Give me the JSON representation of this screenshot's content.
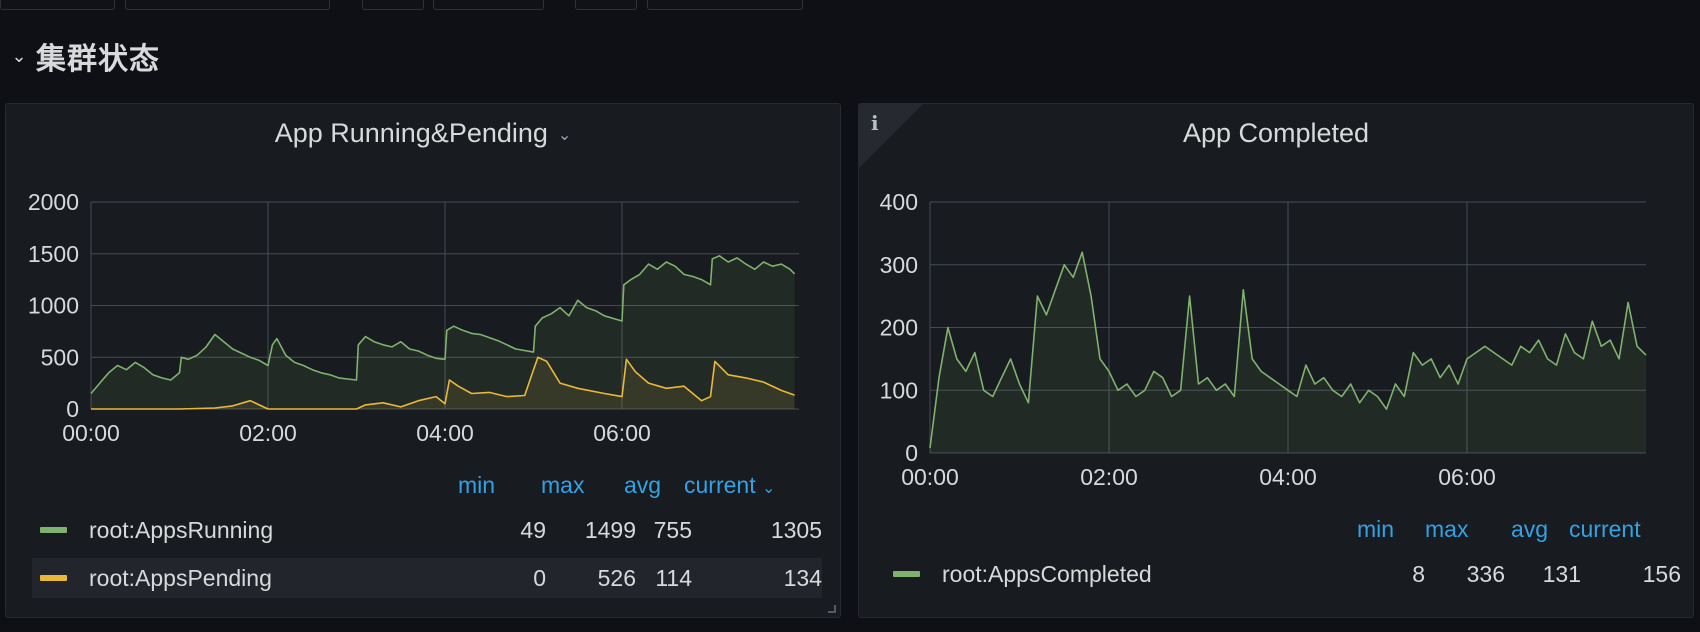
{
  "row": {
    "title": "集群状态",
    "collapse_icon": "chevron-down-icon"
  },
  "colors": {
    "background": "#0f1015",
    "panel_bg": "#181b1f",
    "grid": "#464c54",
    "running": "#7eb26d",
    "pending": "#eab839",
    "completed": "#7eb26d",
    "legend_header": "#33a2e5"
  },
  "panels": [
    {
      "title": "App Running&Pending",
      "menu_icon": "chevron-down-icon",
      "legend": {
        "headers": {
          "min": "min",
          "max": "max",
          "avg": "avg",
          "current": "current"
        },
        "sort_icon": "chevron-down-icon",
        "rows": [
          {
            "name": "root:AppsRunning",
            "min": "49",
            "max": "1499",
            "avg": "755",
            "current": "1305"
          },
          {
            "name": "root:AppsPending",
            "min": "0",
            "max": "526",
            "avg": "114",
            "current": "134"
          }
        ]
      }
    },
    {
      "title": "App Completed",
      "info_icon": "info-icon",
      "legend": {
        "headers": {
          "min": "min",
          "max": "max",
          "avg": "avg",
          "current": "current"
        },
        "rows": [
          {
            "name": "root:AppsCompleted",
            "min": "8",
            "max": "336",
            "avg": "131",
            "current": "156"
          }
        ]
      }
    }
  ],
  "chart_data": [
    {
      "type": "area",
      "x_ticks": [
        "00:00",
        "02:00",
        "04:00",
        "06:00"
      ],
      "x_range": [
        0,
        8
      ],
      "ylim": [
        0,
        2000
      ],
      "y_ticks": [
        "0",
        "500",
        "1000",
        "1500",
        "2000"
      ],
      "y_tick_values": [
        0,
        500,
        1000,
        1500,
        2000
      ],
      "grid": true,
      "series": [
        {
          "name": "root:AppsRunning",
          "color": "#7eb26d",
          "x": [
            0,
            0.1,
            0.2,
            0.3,
            0.4,
            0.5,
            0.6,
            0.7,
            0.8,
            0.9,
            1.0,
            1.02,
            1.1,
            1.2,
            1.3,
            1.4,
            1.5,
            1.6,
            1.7,
            1.8,
            1.9,
            2.0,
            2.05,
            2.1,
            2.2,
            2.3,
            2.4,
            2.5,
            2.6,
            2.7,
            2.8,
            2.9,
            3.0,
            3.02,
            3.1,
            3.2,
            3.3,
            3.4,
            3.5,
            3.6,
            3.7,
            3.8,
            3.9,
            4.0,
            4.02,
            4.1,
            4.2,
            4.3,
            4.4,
            4.5,
            4.6,
            4.7,
            4.8,
            5.0,
            5.02,
            5.1,
            5.2,
            5.3,
            5.4,
            5.5,
            5.6,
            5.7,
            5.8,
            6.0,
            6.02,
            6.1,
            6.2,
            6.3,
            6.4,
            6.5,
            6.6,
            6.7,
            6.8,
            6.9,
            7.0,
            7.02,
            7.1,
            7.2,
            7.3,
            7.4,
            7.5,
            7.6,
            7.7,
            7.8,
            7.9,
            7.95
          ],
          "values": [
            150,
            250,
            350,
            420,
            380,
            450,
            400,
            330,
            300,
            280,
            350,
            500,
            480,
            520,
            600,
            720,
            650,
            580,
            540,
            500,
            470,
            420,
            620,
            680,
            520,
            450,
            420,
            380,
            350,
            330,
            300,
            290,
            280,
            620,
            700,
            650,
            620,
            600,
            650,
            580,
            560,
            520,
            490,
            480,
            760,
            800,
            760,
            730,
            720,
            690,
            660,
            620,
            580,
            550,
            800,
            880,
            920,
            980,
            900,
            1050,
            980,
            950,
            900,
            850,
            1200,
            1250,
            1300,
            1400,
            1350,
            1420,
            1380,
            1300,
            1280,
            1250,
            1200,
            1450,
            1480,
            1420,
            1460,
            1400,
            1350,
            1420,
            1380,
            1400,
            1350,
            1305
          ]
        },
        {
          "name": "root:AppsPending",
          "color": "#eab839",
          "x": [
            0,
            0.5,
            1.0,
            1.4,
            1.6,
            1.8,
            2.0,
            2.5,
            3.0,
            3.1,
            3.3,
            3.5,
            3.7,
            3.9,
            4.0,
            4.05,
            4.15,
            4.3,
            4.5,
            4.7,
            4.9,
            5.0,
            5.05,
            5.15,
            5.3,
            5.5,
            5.8,
            6.0,
            6.05,
            6.15,
            6.3,
            6.5,
            6.7,
            6.9,
            7.0,
            7.05,
            7.2,
            7.4,
            7.6,
            7.8,
            7.95
          ],
          "values": [
            0,
            0,
            0,
            10,
            30,
            80,
            0,
            0,
            0,
            40,
            60,
            20,
            80,
            120,
            50,
            280,
            220,
            150,
            160,
            120,
            130,
            380,
            500,
            460,
            250,
            200,
            150,
            120,
            480,
            360,
            250,
            200,
            220,
            80,
            120,
            460,
            330,
            300,
            260,
            180,
            134
          ]
        }
      ]
    },
    {
      "type": "area",
      "x_ticks": [
        "00:00",
        "02:00",
        "04:00",
        "06:00"
      ],
      "x_range": [
        0,
        8
      ],
      "ylim": [
        0,
        400
      ],
      "y_ticks": [
        "0",
        "100",
        "200",
        "300",
        "400"
      ],
      "y_tick_values": [
        0,
        100,
        200,
        300,
        400
      ],
      "grid": true,
      "series": [
        {
          "name": "root:AppsCompleted",
          "color": "#7eb26d",
          "x": [
            0,
            0.1,
            0.2,
            0.3,
            0.4,
            0.5,
            0.6,
            0.7,
            0.8,
            0.9,
            1.0,
            1.1,
            1.2,
            1.3,
            1.4,
            1.5,
            1.6,
            1.7,
            1.8,
            1.9,
            2.0,
            2.1,
            2.2,
            2.3,
            2.4,
            2.5,
            2.6,
            2.7,
            2.8,
            2.9,
            3.0,
            3.1,
            3.2,
            3.3,
            3.4,
            3.5,
            3.6,
            3.7,
            3.8,
            3.9,
            4.0,
            4.1,
            4.2,
            4.3,
            4.4,
            4.5,
            4.6,
            4.7,
            4.8,
            4.9,
            5.0,
            5.1,
            5.2,
            5.3,
            5.4,
            5.5,
            5.6,
            5.7,
            5.8,
            5.9,
            6.0,
            6.1,
            6.2,
            6.3,
            6.4,
            6.5,
            6.6,
            6.7,
            6.8,
            6.9,
            7.0,
            7.1,
            7.2,
            7.3,
            7.4,
            7.5,
            7.6,
            7.7,
            7.8,
            7.9,
            8.0
          ],
          "values": [
            8,
            120,
            200,
            150,
            130,
            160,
            100,
            90,
            120,
            150,
            110,
            80,
            250,
            220,
            260,
            300,
            280,
            320,
            250,
            150,
            130,
            100,
            110,
            90,
            100,
            130,
            120,
            90,
            100,
            250,
            110,
            120,
            100,
            110,
            90,
            260,
            150,
            130,
            120,
            110,
            100,
            90,
            140,
            110,
            120,
            100,
            90,
            110,
            80,
            100,
            90,
            70,
            110,
            90,
            160,
            140,
            150,
            120,
            140,
            110,
            150,
            160,
            170,
            160,
            150,
            140,
            170,
            160,
            180,
            150,
            140,
            190,
            160,
            150,
            210,
            170,
            180,
            150,
            240,
            170,
            156
          ]
        }
      ]
    }
  ]
}
